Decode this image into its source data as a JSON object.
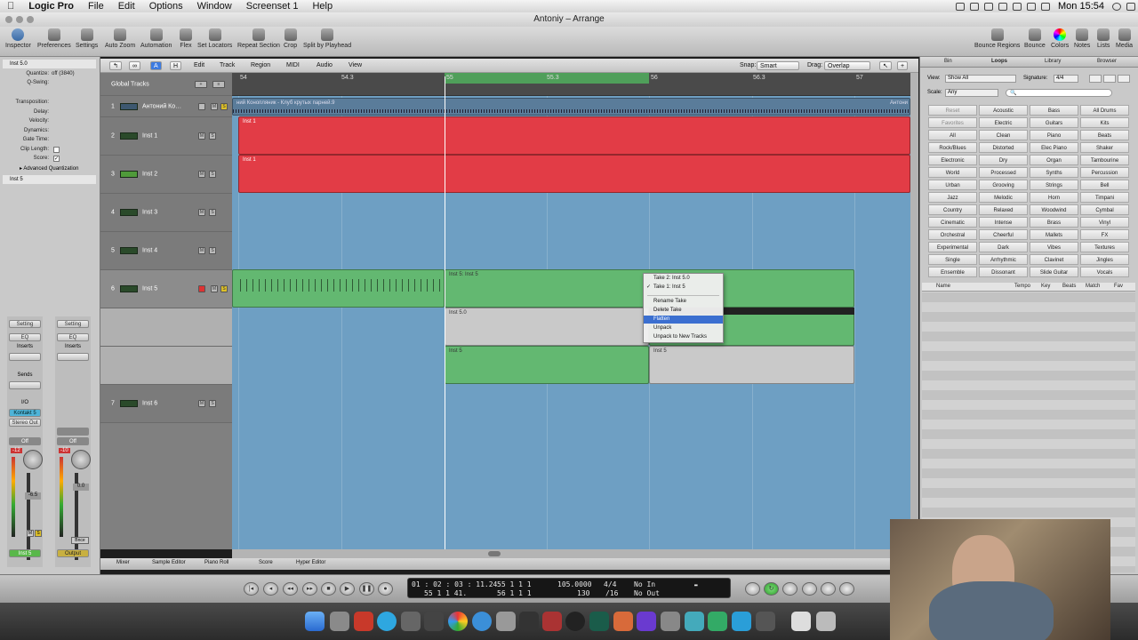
{
  "menubar": {
    "app": "Logic Pro",
    "items": [
      "File",
      "Edit",
      "Options",
      "Window",
      "Screenset 1",
      "Help"
    ],
    "clock": "Mon 15:54"
  },
  "window": {
    "title": "Antoniy – Arrange"
  },
  "toolbar": {
    "left": [
      "Inspector",
      "Preferences",
      "Settings",
      "Auto Zoom",
      "Automation",
      "Flex",
      "Set Locators",
      "Repeat Section",
      "Crop",
      "Split by Playhead"
    ],
    "right": [
      "Bounce Regions",
      "Bounce",
      "Colors",
      "Notes",
      "Lists",
      "Media"
    ]
  },
  "inspector": {
    "region_header": "Inst 5.0",
    "params": [
      {
        "label": "Quantize:",
        "value": "off (3840)"
      },
      {
        "label": "Q-Swing:",
        "value": ""
      },
      {
        "label": "Transposition:",
        "value": ""
      },
      {
        "label": "Delay:",
        "value": ""
      },
      {
        "label": "Velocity:",
        "value": ""
      },
      {
        "label": "Dynamics:",
        "value": ""
      },
      {
        "label": "Gate Time:",
        "value": ""
      },
      {
        "label": "Clip Length:",
        "value": ""
      },
      {
        "label": "Score:",
        "value": ""
      }
    ],
    "adv_quant": "Advanced Quantization",
    "track_header": "Inst 5",
    "strip1": {
      "setting": "Setting",
      "eq": "EQ",
      "inserts": "Inserts",
      "sends": "Sends",
      "io": "I/O",
      "input": "Kontakt 5",
      "output": "Stereo Out",
      "auto": "Off",
      "level": "-12",
      "pan": "-6.5",
      "name": "Inst 5"
    },
    "strip2": {
      "setting": "Setting",
      "eq": "EQ",
      "inserts": "Inserts",
      "auto": "Off",
      "level": "-10",
      "pan": "0.0",
      "bnce": "Bnce",
      "name": "Output"
    }
  },
  "arrange_menu": [
    "Edit",
    "Track",
    "Region",
    "MIDI",
    "Audio",
    "View"
  ],
  "snap": {
    "label": "Snap:",
    "value": "Smart"
  },
  "drag": {
    "label": "Drag:",
    "value": "Overlap"
  },
  "global_tracks": "Global Tracks",
  "ruler": [
    "54",
    "54.3",
    "55",
    "55.3",
    "56",
    "56.3",
    "57"
  ],
  "tracks": [
    {
      "num": "1",
      "name": "Антоний Ко…"
    },
    {
      "num": "2",
      "name": "Inst 1"
    },
    {
      "num": "3",
      "name": "Inst 2"
    },
    {
      "num": "4",
      "name": "Inst 3"
    },
    {
      "num": "5",
      "name": "Inst 4"
    },
    {
      "num": "6",
      "name": "Inst 5"
    },
    {
      "num": "7",
      "name": "Inst 6"
    }
  ],
  "regions": {
    "audio1": "ний Конопляник - Клуб крутых парней.9",
    "audio1_end": "Антони",
    "inst1": "Inst 1",
    "inst2": "Inst 1",
    "take_folder": "Inst 5: Inst 5",
    "take_a": "Inst 5.0",
    "take_b": "Inst 5",
    "take_c": "Inst 5"
  },
  "context_menu": {
    "items": [
      "Take 2: Inst 5.0",
      "Take 1: Inst 5",
      "Rename Take",
      "Delete Take",
      "Flatten",
      "Unpack",
      "Unpack to New Tracks"
    ],
    "checked": "Take 1: Inst 5",
    "highlighted": "Flatten"
  },
  "bottom_tabs": [
    "Mixer",
    "Sample Editor",
    "Piano Roll",
    "Score",
    "Hyper Editor"
  ],
  "browser": {
    "tabs": [
      "Bin",
      "Loops",
      "Library",
      "Browser"
    ],
    "active_tab": "Loops",
    "view_label": "View:",
    "view_value": "Show All",
    "sig_label": "Signature:",
    "sig_value": "4/4",
    "scale_label": "Scale:",
    "scale_value": "Any",
    "keywords": [
      [
        "Reset",
        "Acoustic",
        "Bass",
        "All Drums"
      ],
      [
        "Favorites",
        "Electric",
        "Guitars",
        "Kits"
      ],
      [
        "All",
        "Clean",
        "Piano",
        "Beats"
      ],
      [
        "Rock/Blues",
        "Distorted",
        "Elec Piano",
        "Shaker"
      ],
      [
        "Electronic",
        "Dry",
        "Organ",
        "Tambourine"
      ],
      [
        "World",
        "Processed",
        "Synths",
        "Percussion"
      ],
      [
        "Urban",
        "Grooving",
        "Strings",
        "Bell"
      ],
      [
        "Jazz",
        "Melodic",
        "Horn",
        "Timpani"
      ],
      [
        "Country",
        "Relaxed",
        "Woodwind",
        "Cymbal"
      ],
      [
        "Cinematic",
        "Intense",
        "Brass",
        "Vinyl"
      ],
      [
        "Orchestral",
        "Cheerful",
        "Mallets",
        "FX"
      ],
      [
        "Experimental",
        "Dark",
        "Vibes",
        "Textures"
      ],
      [
        "Single",
        "Arrhythmic",
        "Clavinet",
        "Jingles"
      ],
      [
        "Ensemble",
        "Dissonant",
        "Slide Guitar",
        "Vocals"
      ]
    ],
    "columns": [
      "Name",
      "Tempo",
      "Key",
      "Beats",
      "Match",
      "Fav"
    ]
  },
  "transport": {
    "smpte": "01 : 02 : 03 : 11.24",
    "bars": "55   1   1   41.",
    "pos1": "55    1    1    1",
    "pos2": "56    1    1    1",
    "tempo": "105.0000",
    "tempo2": "130",
    "sig": "4/4",
    "div": "/16",
    "in": "No In",
    "out": "No Out"
  }
}
